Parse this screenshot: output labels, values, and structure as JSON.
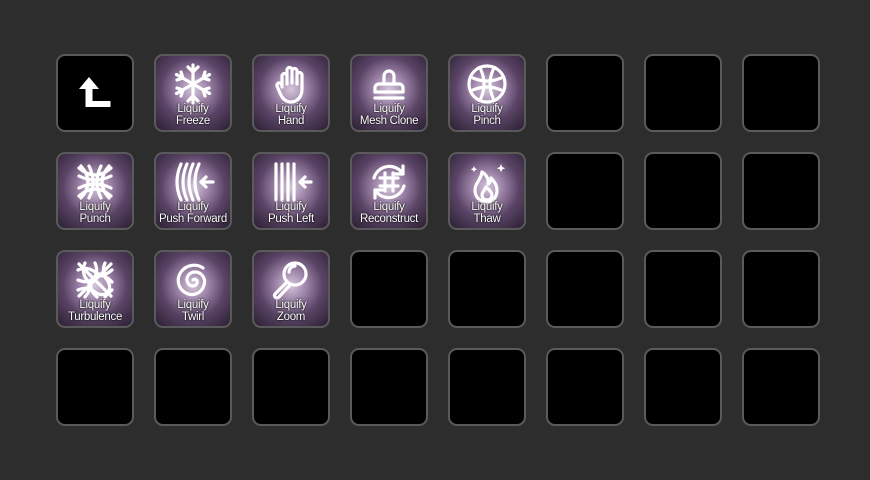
{
  "colors": {
    "background": "#2d2d2d",
    "key_border": "#5a5a5a",
    "empty_key": "#000000",
    "action_glow": "#9d84a8",
    "icon": "#ffffff"
  },
  "keys": [
    {
      "type": "back",
      "icon": "back-arrow-icon"
    },
    {
      "type": "action",
      "line1": "Liquify",
      "line2": "Freeze",
      "icon": "snowflake-icon"
    },
    {
      "type": "action",
      "line1": "Liquify",
      "line2": "Hand",
      "icon": "hand-icon"
    },
    {
      "type": "action",
      "line1": "Liquify",
      "line2": "Mesh Clone",
      "icon": "stamp-icon"
    },
    {
      "type": "action",
      "line1": "Liquify",
      "line2": "Pinch",
      "icon": "pinch-icon"
    },
    {
      "type": "action",
      "line1": "Liquify",
      "line2": "Punch",
      "icon": "punch-icon"
    },
    {
      "type": "action",
      "line1": "Liquify",
      "line2": "Push Forward",
      "icon": "push-forward-icon"
    },
    {
      "type": "action",
      "line1": "Liquify",
      "line2": "Push Left",
      "icon": "push-left-icon"
    },
    {
      "type": "action",
      "line1": "Liquify",
      "line2": "Reconstruct",
      "icon": "reconstruct-icon"
    },
    {
      "type": "action",
      "line1": "Liquify",
      "line2": "Thaw",
      "icon": "flame-icon"
    },
    {
      "type": "action",
      "line1": "Liquify",
      "line2": "Turbulence",
      "icon": "turbulence-icon"
    },
    {
      "type": "action",
      "line1": "Liquify",
      "line2": "Twirl",
      "icon": "spiral-icon"
    },
    {
      "type": "action",
      "line1": "Liquify",
      "line2": "Zoom",
      "icon": "magnifier-icon"
    }
  ]
}
